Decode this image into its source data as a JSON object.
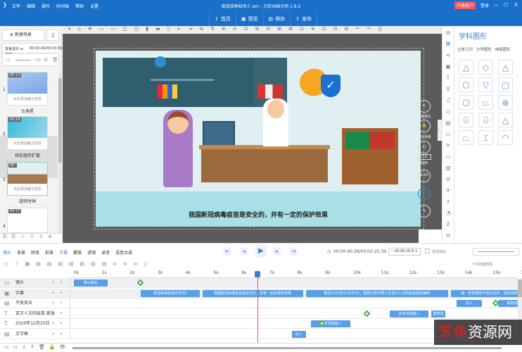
{
  "titlebar": {
    "logo": "❯",
    "menu": [
      "文件",
      "编辑",
      "操作",
      "时间轴",
      "帮助",
      "设置"
    ],
    "title": "疫苗接种知多少.am - 万彩动画大师 2.8.5",
    "upgrade": "升级账户",
    "login": "登录",
    "controls": [
      "—",
      "☐",
      "X"
    ]
  },
  "toolbar": [
    {
      "icon": "home-icon",
      "label": "首页"
    },
    {
      "icon": "preview-icon",
      "label": "预览"
    },
    {
      "icon": "save-icon",
      "label": "保存"
    },
    {
      "icon": "publish-icon",
      "label": "发布"
    }
  ],
  "left": {
    "new_scene": "新建场景",
    "music": "背景音乐.m",
    "music_time": "00:00:40/00:03:39",
    "scenes": [
      {
        "num": "1",
        "time": "00:13",
        "note": "点击添加备注信息",
        "name": "五角星"
      },
      {
        "num": "2",
        "time": "00:16",
        "note": "点击添加备注信息",
        "name": "矩形旋转扩散"
      },
      {
        "num": "3",
        "time": "00:",
        "note": "点击添加备注信息",
        "name": "旋转时钟"
      },
      {
        "num": "4",
        "time": "00:17"
      }
    ]
  },
  "stage": {
    "caption": "我国新冠病毒疫苗是安全的，并有一定的保护效果"
  },
  "camera_controls": {
    "reset": "重置镜头",
    "lock": "锁定场景",
    "rotate": "旋转",
    "rotate_value": "0.0",
    "ratio_916": "9:16",
    "ratio_169": "16:9"
  },
  "right": {
    "title": "学科图形",
    "tabs": [
      "立体几何",
      "力学图形",
      "电路图形"
    ],
    "shapes": [
      "△",
      "◇",
      "△",
      "⬡",
      "▽",
      "▢",
      "⬡",
      "⏢",
      "⊕",
      "⌸",
      "⌸",
      "△",
      "⏢",
      "⌶",
      "◠"
    ]
  },
  "timeline": {
    "tools": [
      "镜头",
      "背景",
      "特效",
      "前景",
      "字幕",
      "蒙版",
      "滤镜",
      "录音",
      "语音合成"
    ],
    "time": "00:00:40.28/00:02:25.39",
    "zoom": "00:00:16.8",
    "auto_fit": "自动适应",
    "help": "时间轴帮助",
    "ticks": [
      "0s",
      "1s",
      "2s",
      "3s",
      "4s",
      "5s",
      "6s",
      "7s",
      "8s",
      "9s",
      "10s",
      "11s",
      "12s",
      "13s",
      "14s",
      "15s",
      "16s"
    ],
    "tracks": [
      {
        "label": "镜头",
        "icon": "camera-icon"
      },
      {
        "label": "字幕",
        "icon": "subtitle-icon"
      },
      {
        "label": "不良反应",
        "icon": "textbox-icon"
      },
      {
        "label": "百万人次的疫苗 紧急",
        "icon": "text-icon"
      },
      {
        "label": "2020年12月25日",
        "icon": "text-icon"
      },
      {
        "label": "文字框",
        "icon": "textbox-icon"
      }
    ],
    "bars": {
      "camera": "默认镜头",
      "sub1": "新冠病毒疫苗安全吗?",
      "sub2": "我国新冠病毒疫苗是安全的，并有一定的保护效果",
      "sub3": "截至2020年12月25日，我国已经开展了近百万人次的疫苗紧急接种",
      "sub4": "除一些轻微的不良反应外，没有出现严重",
      "t1a": "淡入",
      "t1b": "颜色进",
      "t2a": "文本光标输入",
      "t2b": "渐变进",
      "t3a": "文本光标输入",
      "t4a": "淡入"
    }
  },
  "watermark": "笨鱼资源网",
  "colors": {
    "brand": "#1a6fc9",
    "upgrade": "#f05a5a",
    "bar": "#5a9ee6",
    "playhead": "#f05050"
  }
}
